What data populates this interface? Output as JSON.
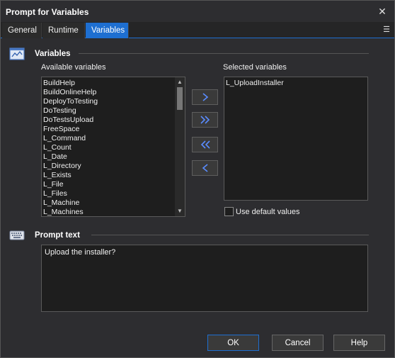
{
  "window": {
    "title": "Prompt for Variables",
    "close_icon": "close-icon"
  },
  "tabs": [
    {
      "label": "General",
      "active": false
    },
    {
      "label": "Runtime",
      "active": false
    },
    {
      "label": "Variables",
      "active": true
    }
  ],
  "variables_section": {
    "title": "Variables",
    "icon": "variables-icon",
    "available_label": "Available variables",
    "available_items": [
      "BuildHelp",
      "BuildOnlineHelp",
      "DeployToTesting",
      "DoTesting",
      "DoTestsUpload",
      "FreeSpace",
      "L_Command",
      "L_Count",
      "L_Date",
      "L_Directory",
      "L_Exists",
      "L_File",
      "L_Files",
      "L_Machine",
      "L_Machines"
    ],
    "selected_label": "Selected variables",
    "selected_items": [
      "L_UploadInstaller"
    ],
    "use_default_label": "Use default values",
    "use_default_checked": false
  },
  "prompt_section": {
    "title": "Prompt text",
    "icon": "keyboard-icon",
    "text": "Upload the installer?"
  },
  "buttons": {
    "ok": "OK",
    "cancel": "Cancel",
    "help": "Help"
  },
  "colors": {
    "accent": "#1e6fd1",
    "background": "#2d2d30",
    "field_background": "#1e1e1e",
    "arrow_color": "#5a8cff"
  }
}
